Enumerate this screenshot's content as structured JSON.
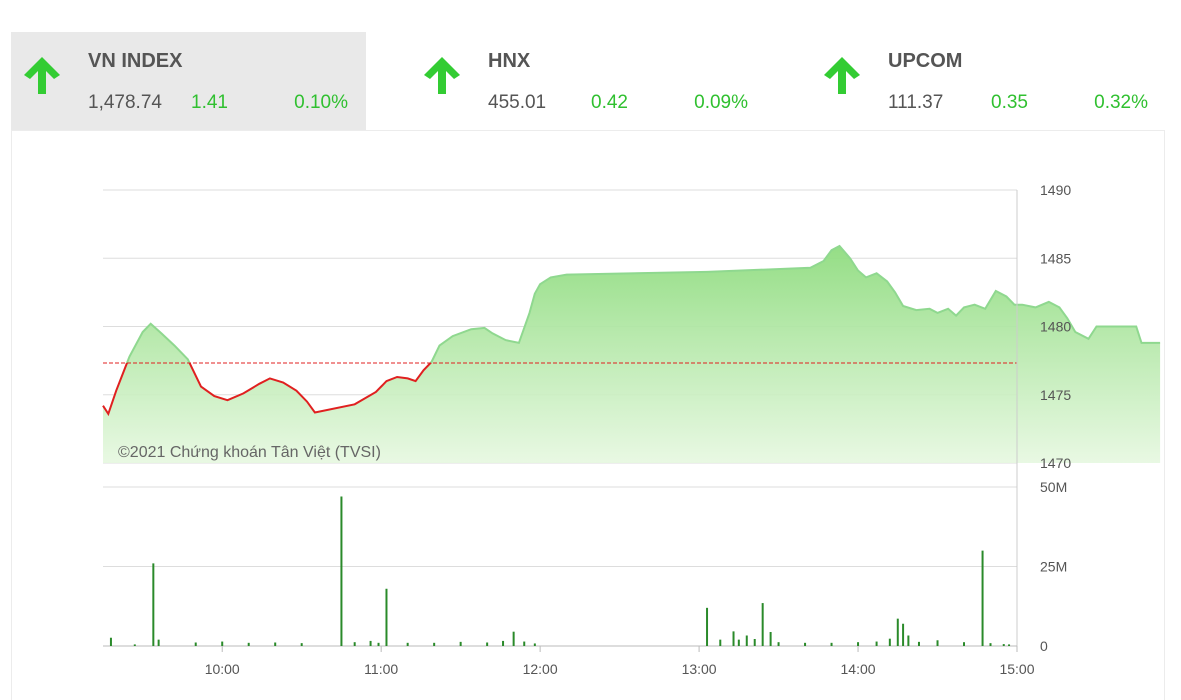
{
  "indices": [
    {
      "name": "VN INDEX",
      "value": "1,478.74",
      "change": "1.41",
      "percent": "0.10%",
      "active": true,
      "direction": "up-arrow-icon"
    },
    {
      "name": "HNX",
      "value": "455.01",
      "change": "0.42",
      "percent": "0.09%",
      "active": false,
      "direction": "up-arrow-icon"
    },
    {
      "name": "UPCOM",
      "value": "111.37",
      "change": "0.35",
      "percent": "0.32%",
      "active": false,
      "direction": "up-arrow-icon"
    }
  ],
  "colors": {
    "up": "#33cc33",
    "down_line": "#e02020",
    "up_line": "#8fd88f",
    "reference_line": "#e02020",
    "volume": "#2a8a2a",
    "grid": "#dddddd"
  },
  "chart_data": {
    "type": "area",
    "watermark": "©2021 Chứng khoán Tân Việt (TVSI)",
    "reference_value": 1477.33,
    "price_axis": {
      "range": [
        1470,
        1490
      ],
      "ticks": [
        "1470",
        "1475",
        "1480",
        "1485",
        "1490"
      ]
    },
    "time_axis": {
      "range": [
        "09:15",
        "15:00"
      ],
      "ticks": [
        "10:00",
        "11:00",
        "12:00",
        "13:00",
        "14:00",
        "15:00"
      ]
    },
    "volume_axis": {
      "range": [
        0,
        50
      ],
      "unit": "M",
      "ticks": [
        "0",
        "25M",
        "50M"
      ]
    },
    "price_series": [
      [
        "09:15",
        1474.2
      ],
      [
        "09:17",
        1473.6
      ],
      [
        "09:20",
        1475.3
      ],
      [
        "09:25",
        1477.8
      ],
      [
        "09:30",
        1479.6
      ],
      [
        "09:33",
        1480.2
      ],
      [
        "09:37",
        1479.5
      ],
      [
        "09:42",
        1478.6
      ],
      [
        "09:47",
        1477.6
      ],
      [
        "09:52",
        1475.6
      ],
      [
        "09:57",
        1474.9
      ],
      [
        "10:02",
        1474.6
      ],
      [
        "10:08",
        1475.1
      ],
      [
        "10:14",
        1475.8
      ],
      [
        "10:18",
        1476.2
      ],
      [
        "10:23",
        1475.9
      ],
      [
        "10:28",
        1475.3
      ],
      [
        "10:32",
        1474.5
      ],
      [
        "10:35",
        1473.7
      ],
      [
        "10:50",
        1474.3
      ],
      [
        "10:58",
        1475.2
      ],
      [
        "11:02",
        1476.0
      ],
      [
        "11:06",
        1476.3
      ],
      [
        "11:10",
        1476.2
      ],
      [
        "11:13",
        1476.0
      ],
      [
        "11:16",
        1476.8
      ],
      [
        "11:19",
        1477.4
      ],
      [
        "11:22",
        1478.6
      ],
      [
        "11:27",
        1479.3
      ],
      [
        "11:34",
        1479.8
      ],
      [
        "11:39",
        1479.9
      ],
      [
        "11:42",
        1479.5
      ],
      [
        "11:47",
        1479.0
      ],
      [
        "11:52",
        1478.8
      ],
      [
        "11:56",
        1481.0
      ],
      [
        "11:58",
        1482.4
      ],
      [
        "12:00",
        1483.1
      ],
      [
        "12:04",
        1483.6
      ],
      [
        "12:10",
        1483.8
      ],
      [
        "13:03",
        1484.0
      ],
      [
        "13:42",
        1484.3
      ],
      [
        "13:47",
        1484.8
      ],
      [
        "13:50",
        1485.6
      ],
      [
        "13:53",
        1485.9
      ],
      [
        "13:57",
        1485.0
      ],
      [
        "14:00",
        1484.1
      ],
      [
        "14:03",
        1483.6
      ],
      [
        "14:07",
        1483.9
      ],
      [
        "14:11",
        1483.3
      ],
      [
        "14:14",
        1482.5
      ],
      [
        "14:17",
        1481.5
      ],
      [
        "14:22",
        1481.2
      ],
      [
        "14:27",
        1481.3
      ],
      [
        "14:30",
        1481.0
      ],
      [
        "14:34",
        1481.3
      ],
      [
        "14:37",
        1480.8
      ],
      [
        "14:40",
        1481.4
      ],
      [
        "14:44",
        1481.6
      ],
      [
        "14:48",
        1481.3
      ],
      [
        "14:52",
        1482.6
      ],
      [
        "14:56",
        1482.2
      ],
      [
        "14:59",
        1481.6
      ],
      [
        "15:02",
        1481.6
      ],
      [
        "15:07",
        1481.4
      ],
      [
        "15:12",
        1481.8
      ],
      [
        "15:16",
        1481.4
      ],
      [
        "15:19",
        1480.6
      ],
      [
        "15:22",
        1479.6
      ],
      [
        "15:27",
        1479.1
      ],
      [
        "15:30",
        1480.0
      ],
      [
        "15:45",
        1480.0
      ],
      [
        "15:47",
        1478.8
      ],
      [
        "15:54",
        1478.8
      ]
    ],
    "volume_series": [
      [
        "09:18",
        2.6
      ],
      [
        "09:27",
        0.5
      ],
      [
        "09:34",
        26.0
      ],
      [
        "09:36",
        2.0
      ],
      [
        "09:50",
        1.1
      ],
      [
        "10:00",
        1.4
      ],
      [
        "10:10",
        1.0
      ],
      [
        "10:20",
        1.1
      ],
      [
        "10:30",
        0.9
      ],
      [
        "10:45",
        47.0
      ],
      [
        "10:50",
        1.2
      ],
      [
        "10:56",
        1.6
      ],
      [
        "10:59",
        1.0
      ],
      [
        "11:02",
        18.0
      ],
      [
        "11:10",
        1.0
      ],
      [
        "11:20",
        1.0
      ],
      [
        "11:30",
        1.3
      ],
      [
        "11:40",
        1.1
      ],
      [
        "11:46",
        1.6
      ],
      [
        "11:50",
        4.5
      ],
      [
        "11:54",
        1.4
      ],
      [
        "11:58",
        0.8
      ],
      [
        "13:03",
        12.0
      ],
      [
        "13:08",
        2.0
      ],
      [
        "13:13",
        4.6
      ],
      [
        "13:15",
        2.0
      ],
      [
        "13:18",
        3.3
      ],
      [
        "13:21",
        2.2
      ],
      [
        "13:24",
        13.5
      ],
      [
        "13:27",
        4.4
      ],
      [
        "13:30",
        1.2
      ],
      [
        "13:40",
        1.0
      ],
      [
        "13:50",
        1.0
      ],
      [
        "14:00",
        1.2
      ],
      [
        "14:07",
        1.4
      ],
      [
        "14:12",
        2.3
      ],
      [
        "14:15",
        8.6
      ],
      [
        "14:17",
        7.0
      ],
      [
        "14:19",
        3.3
      ],
      [
        "14:23",
        1.3
      ],
      [
        "14:30",
        1.8
      ],
      [
        "14:40",
        1.2
      ],
      [
        "14:47",
        30.0
      ],
      [
        "14:50",
        0.9
      ],
      [
        "14:55",
        0.6
      ],
      [
        "14:57",
        0.5
      ]
    ]
  }
}
